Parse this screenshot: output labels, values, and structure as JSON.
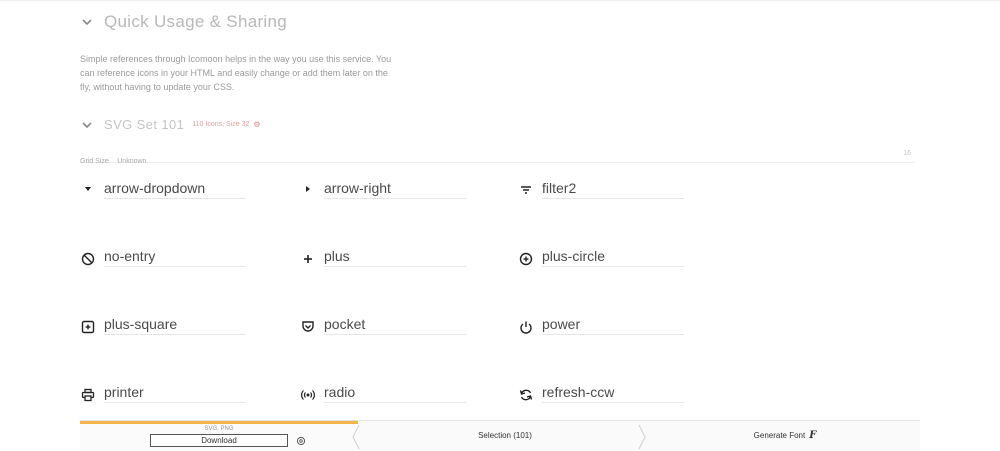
{
  "quick_usage": {
    "title": "Quick Usage & Sharing",
    "description": "Simple references through Icomoon helps in the way you use this service. You can reference icons in your HTML and easily change or add them later on the fly, without having to update your CSS."
  },
  "icon_set": {
    "title": "SVG Set 101",
    "meta": "110 Icons, Size 32",
    "meta_icon": "settings-icon"
  },
  "grid_size": {
    "label": "Grid Size",
    "value": "Unknown",
    "end": "16"
  },
  "glyphs": [
    {
      "name": "arrow-dropdown",
      "icon": "arrow-dropdown-icon"
    },
    {
      "name": "arrow-right",
      "icon": "arrow-right-icon"
    },
    {
      "name": "filter2",
      "icon": "filter-icon"
    },
    {
      "name": "no-entry",
      "icon": "no-entry-icon"
    },
    {
      "name": "plus",
      "icon": "plus-icon"
    },
    {
      "name": "plus-circle",
      "icon": "plus-circle-icon"
    },
    {
      "name": "plus-square",
      "icon": "plus-square-icon"
    },
    {
      "name": "pocket",
      "icon": "pocket-icon"
    },
    {
      "name": "power",
      "icon": "power-icon"
    },
    {
      "name": "printer",
      "icon": "printer-icon"
    },
    {
      "name": "radio",
      "icon": "radio-icon"
    },
    {
      "name": "refresh-ccw",
      "icon": "refresh-ccw-icon"
    }
  ],
  "bottom_bar": {
    "formats": "SVG, PNG",
    "download_label": "Download",
    "selection_label": "Selection (101)",
    "generate_label": "Generate Font",
    "accent_color": "#f3b44a"
  }
}
